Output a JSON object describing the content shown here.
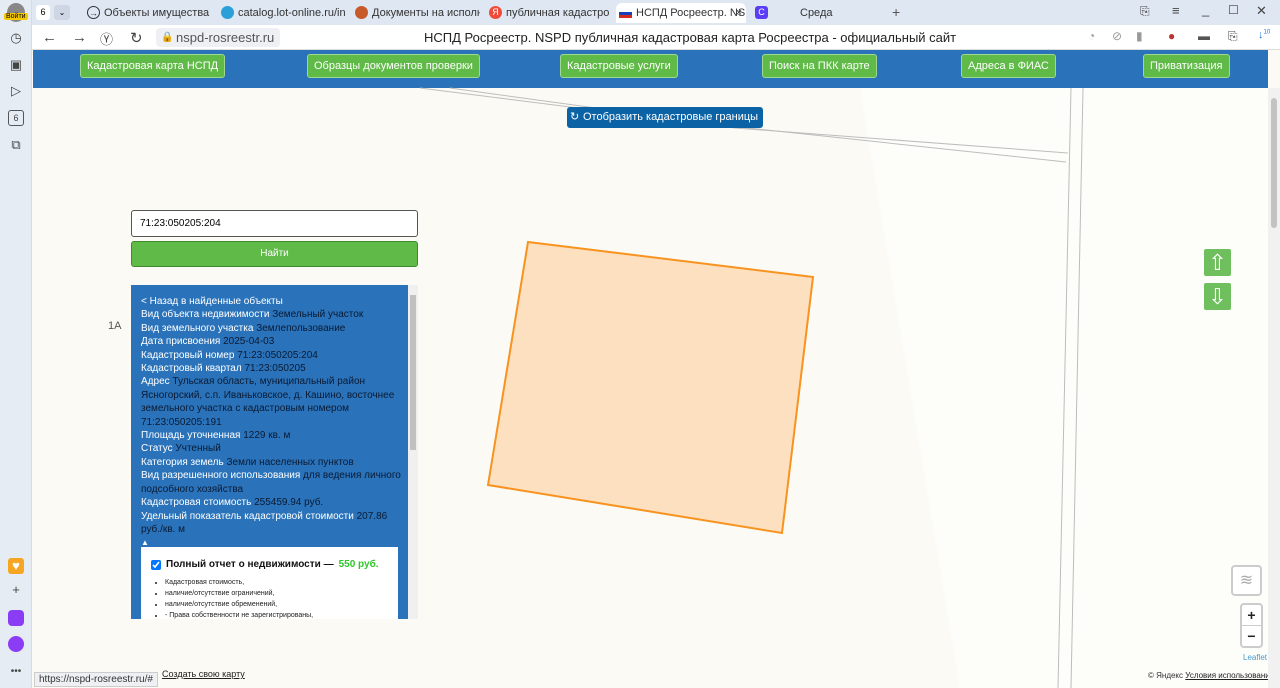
{
  "browser": {
    "profile_label": "Войти",
    "tab_count": "6",
    "tabs": [
      {
        "title": "Объекты имущества - Ф",
        "icon": "arrow-circle-icon",
        "color": "#333333"
      },
      {
        "title": "catalog.lot-online.ru/inde",
        "icon": "lot-online-icon",
        "color": "#2a9fd8"
      },
      {
        "title": "Документы на исполнен",
        "icon": "doc-icon",
        "color": "#c85a2a"
      },
      {
        "title": "публичная кадастровая",
        "icon": "yandex-icon",
        "color": "#f04a3a"
      },
      {
        "title": "НСПД Росреестр. NSPD",
        "icon": "russia-flag-icon",
        "color": "#d52b1e",
        "active": true
      },
      {
        "title": "Среда",
        "icon": "sreda-icon",
        "color": "#5b3df5"
      }
    ],
    "url": "nspd-rosreestr.ru",
    "page_title": "НСПД Росреестр. NSPD публичная кадастровая карта Росреестра - официальный сайт",
    "downloads_badge": "10",
    "status_url": "https://nspd-rosreestr.ru/#"
  },
  "nav": {
    "buttons": [
      "Кадастровая карта НСПД",
      "Образцы документов проверки",
      "Кадастровые услуги",
      "Поиск на ПКК карте",
      "Адреса в ФИАС",
      "Приватизация"
    ]
  },
  "map": {
    "show_borders": "Отобразить кадастровые границы",
    "search_value": "71:23:050205:204",
    "find_label": "Найти",
    "side_label": "1А",
    "plot_fill": "#fde0c0",
    "plot_stroke": "#f7931e",
    "leaflet": "Leaflet",
    "attribution_prefix": "© Яндекс",
    "attribution_link": "Условия использования",
    "create_map": "Создать свою карту"
  },
  "info": {
    "back": "< Назад в найденные объекты",
    "rows": [
      {
        "k": "Вид объекта недвижимости",
        "v": "Земельный участок"
      },
      {
        "k": "Вид земельного участка",
        "v": "Землепользование"
      },
      {
        "k": "Дата присвоения",
        "v": "2025-04-03"
      },
      {
        "k": "Кадастровый номер",
        "v": "71:23:050205:204"
      },
      {
        "k": "Кадастровый квартал",
        "v": "71:23:050205"
      },
      {
        "k": "Адрес",
        "v": "Тульская область, муниципальный район Ясногорский, с.п. Иваньковское, д. Кашино, восточнее земельного участка с кадастровым номером 71:23:050205:191"
      },
      {
        "k": "Площадь уточненная",
        "v": "1229 кв. м"
      },
      {
        "k": "Статус",
        "v": "Учтенный"
      },
      {
        "k": "Категория земель",
        "v": "Земли населенных пунктов"
      },
      {
        "k": "Вид разрешенного использования",
        "v": "для ведения личного подсобного хозяйства"
      },
      {
        "k": "Кадастровая стоимость",
        "v": "255459.94 руб."
      },
      {
        "k": "Удельный показатель кадастровой стоимости",
        "v": "207.86 руб./кв. м"
      }
    ],
    "collapse": "▲",
    "report": {
      "title": "Полный отчет о недвижимости —",
      "price": "550 руб.",
      "checked": true,
      "items": [
        "Кадастровая стоимость,",
        "наличие/отсутствие ограничений,",
        "наличие/отсутствие обременений,",
        "- Права собственности не зарегистрированы,"
      ]
    }
  }
}
